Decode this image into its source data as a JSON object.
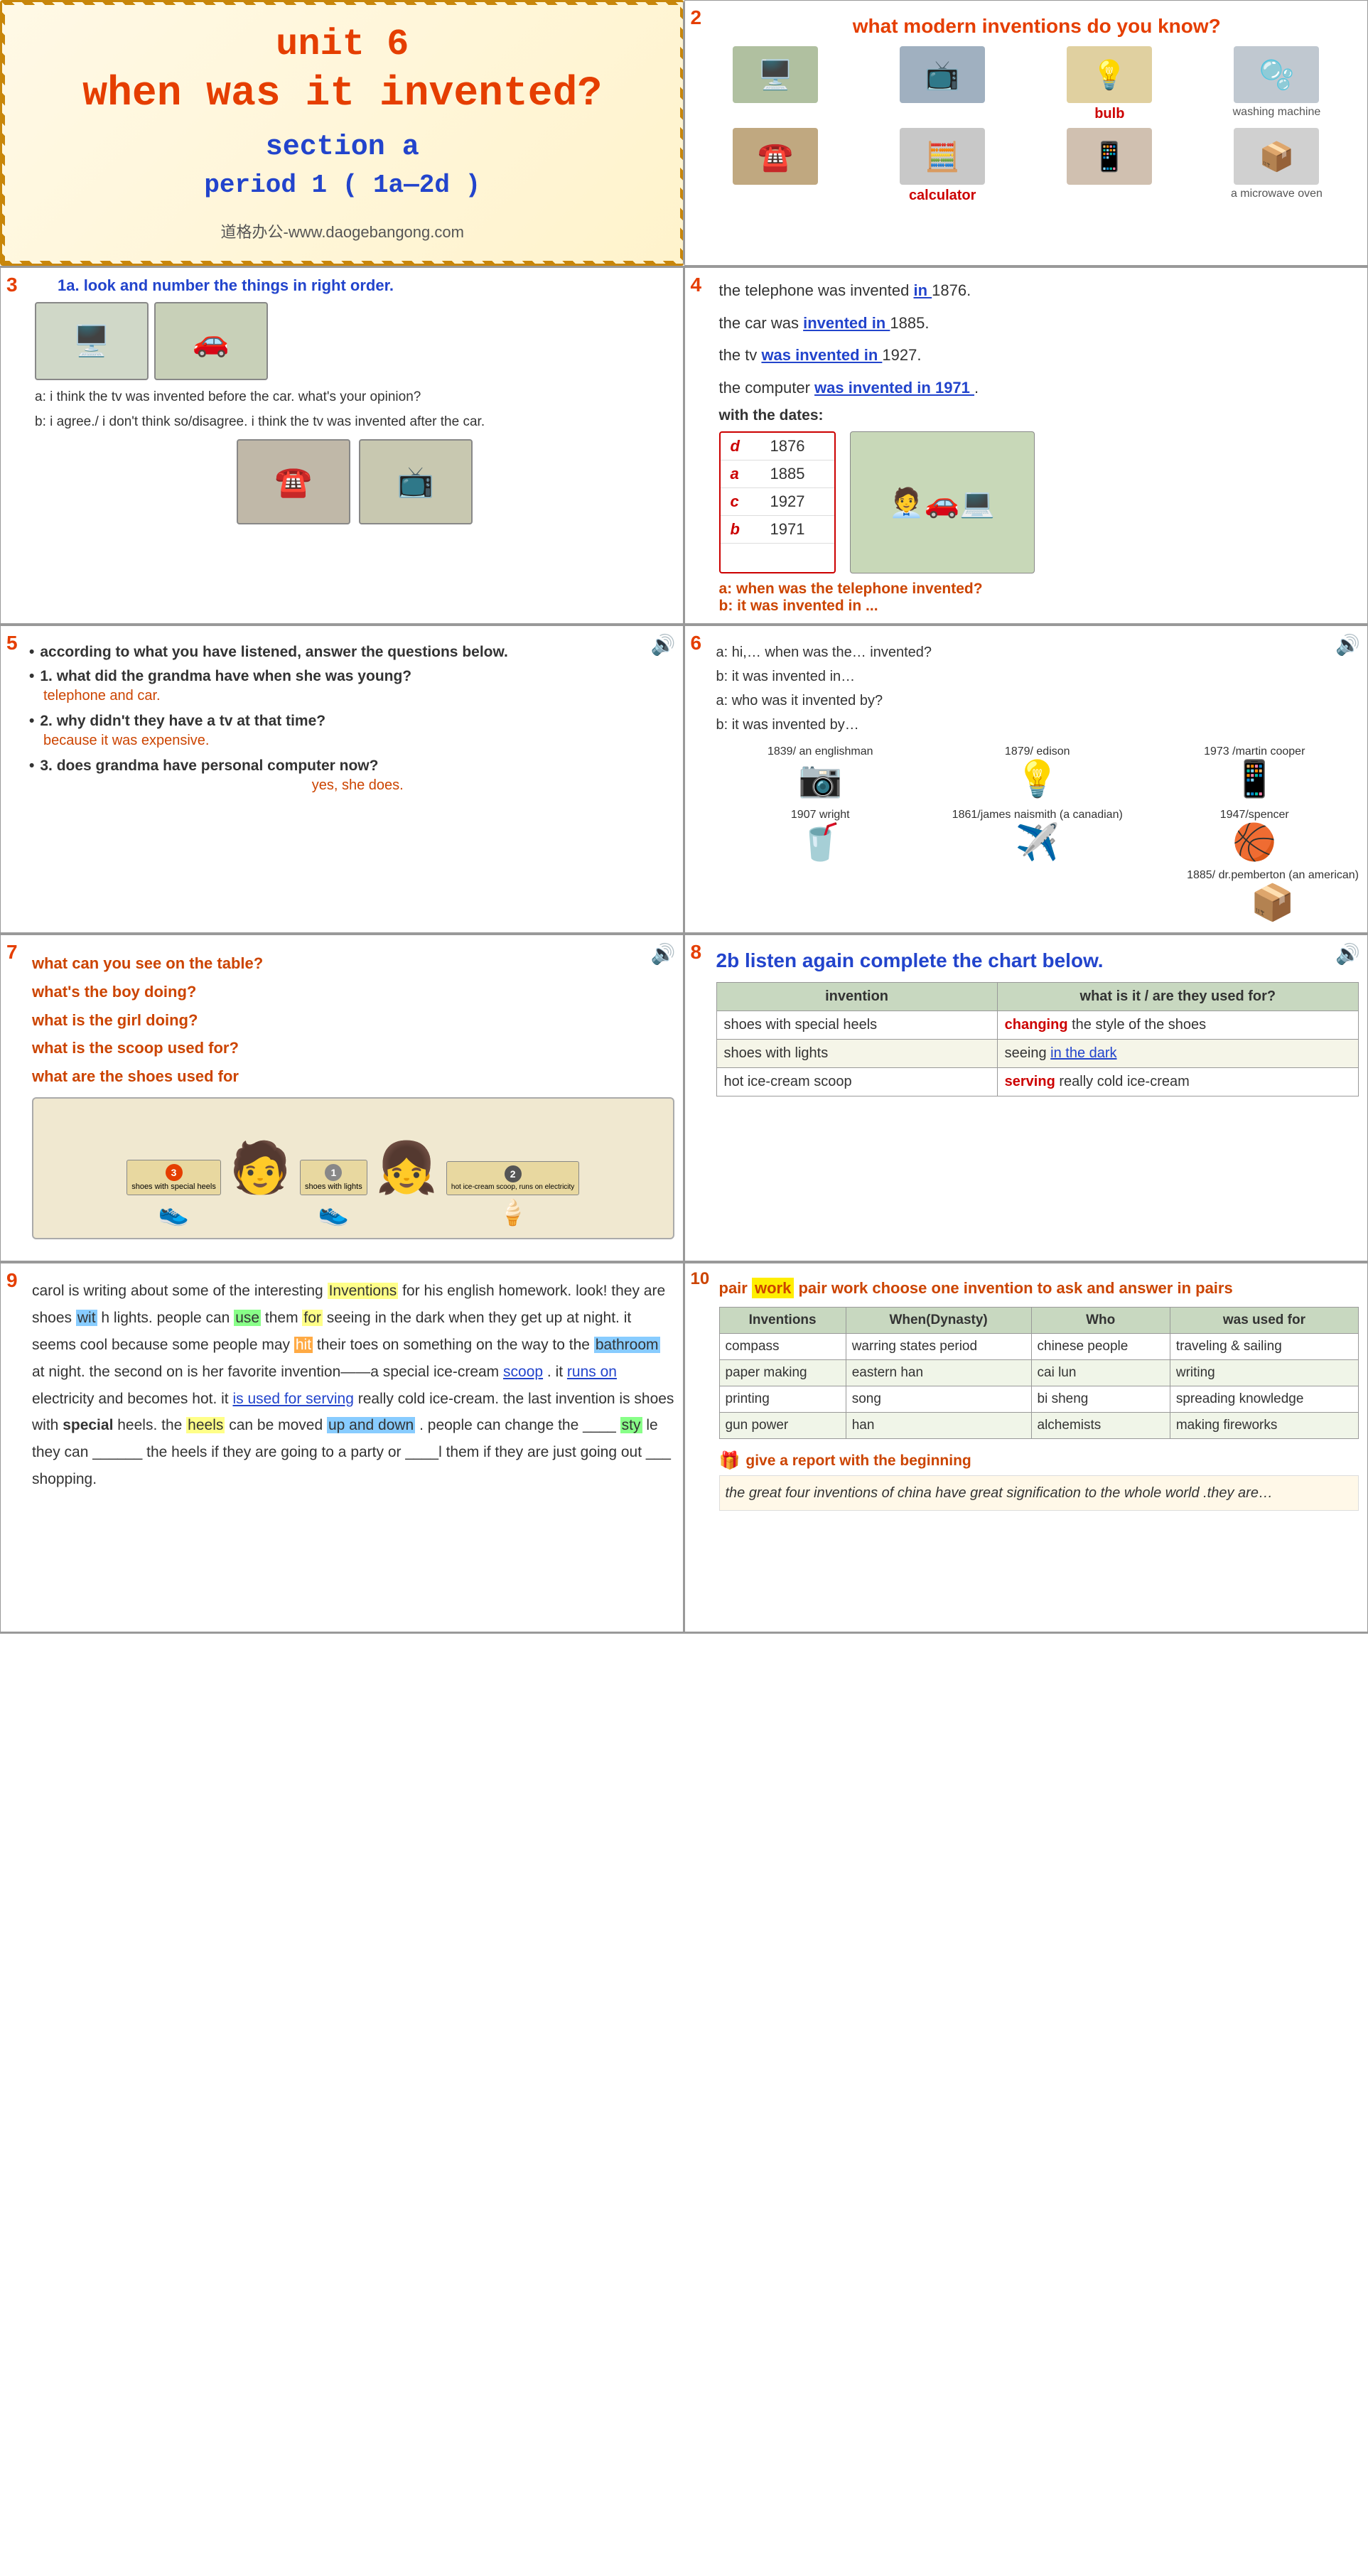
{
  "page": {
    "title": "Unit 6 When Was It Invented?"
  },
  "cell1": {
    "unit": "unit 6",
    "title": "when was it invented?",
    "section": "section a",
    "period": "period 1 ( 1a—2d )",
    "website": "道格办公-www.daogebangong.com"
  },
  "cell2": {
    "num": "2",
    "title": "what modern inventions do you know?",
    "items": [
      {
        "label": "",
        "icon": "🖥️",
        "sublabel": ""
      },
      {
        "label": "",
        "icon": "📺",
        "sublabel": ""
      },
      {
        "label": "bulb",
        "icon": "💡",
        "sublabel": ""
      },
      {
        "label": "",
        "icon": "☎️",
        "sublabel": ""
      },
      {
        "label": "",
        "icon": "🧮",
        "sublabel": ""
      },
      {
        "label": "",
        "icon": "📱",
        "sublabel": ""
      },
      {
        "label": "washing machine",
        "icon": "🫧",
        "sublabel": ""
      },
      {
        "label": "calculator",
        "icon": "🧮",
        "sublabel": ""
      },
      {
        "label": "a microwave oven",
        "icon": "📦",
        "sublabel": ""
      }
    ]
  },
  "cell3": {
    "num": "3",
    "header": "1a. look and number the things in right order.",
    "dialogue_a": "a: i think the tv was invented before the car. what's your opinion?",
    "dialogue_b": "b: i agree./ i don't think so/disagree. i think the tv was invented after the car."
  },
  "cell4": {
    "num": "4",
    "lines": [
      {
        "text": "the telephone was invented",
        "blank": "in",
        "rest": "1876."
      },
      {
        "text": "the car was",
        "blank": "invented in",
        "rest": "1885."
      },
      {
        "text": "the tv",
        "blank": "was invented in",
        "rest": "1927."
      },
      {
        "text": "the computer",
        "blank": "was invented in  1971",
        "rest": "."
      }
    ],
    "subtitle": "with the dates:",
    "dates": [
      {
        "letter": "d",
        "year": "1876"
      },
      {
        "letter": "a",
        "year": "1885"
      },
      {
        "letter": "c",
        "year": "1927"
      },
      {
        "letter": "b",
        "year": "1971"
      }
    ],
    "dialogue_a": "a: when was the telephone invented?",
    "dialogue_b": "b: it was invented in ..."
  },
  "cell5": {
    "num": "5",
    "bullet1": "according to what you have listened, answer the questions below.",
    "q1": "1. what did the grandma have when she was young?",
    "a1": "telephone and car.",
    "q2": "2. why didn't they have a tv at that time?",
    "a2": "because it was expensive.",
    "q3": "3. does grandma have personal computer now?",
    "a3": "yes, she does."
  },
  "cell6": {
    "num": "6",
    "dialogue": [
      "a: hi,… when was the… invented?",
      "b: it was invented in…",
      "a: who was it invented by?",
      "b: it was invented by…"
    ],
    "inventors": [
      {
        "year": "1839/ an englishman",
        "icon": "📷",
        "item": "camera"
      },
      {
        "year": "1879/ edison",
        "icon": "💡",
        "item": "bulb"
      },
      {
        "year": "1973 /martin cooper",
        "icon": "📱",
        "item": "mobile"
      },
      {
        "year": "1885/ dr.pemberton (an american)",
        "icon": "🥤",
        "item": "cola"
      },
      {
        "year": "1907 wright",
        "icon": "✈️",
        "item": "airplane"
      },
      {
        "year": "1861/james naismith (a canadian)",
        "icon": "🏀",
        "item": "basketball"
      },
      {
        "year": "1947/spencer",
        "icon": "📦",
        "item": "microwave"
      }
    ]
  },
  "cell7": {
    "num": "7",
    "questions": [
      "what can you see on the table?",
      "what's the boy doing?",
      "what is the girl doing?",
      "what is the scoop used for?",
      "what are the shoes used for"
    ],
    "scene_items": [
      {
        "num": "3",
        "label": "shoes with special heels"
      },
      {
        "num": "1",
        "label": "shoes with lights"
      },
      {
        "num": "2",
        "label": "hot ice-cream scoop, runs on electricity"
      }
    ]
  },
  "cell8": {
    "num": "8",
    "title": "2b  listen again complete the chart below.",
    "col1": "invention",
    "col2": "what is it / are they used for?",
    "rows": [
      {
        "invention": "shoes with special heels",
        "fill1": "changing",
        "fill2": "the style of the shoes"
      },
      {
        "invention": "shoes with lights",
        "fill1": "seeing",
        "fill2": "in the dark"
      },
      {
        "invention": "hot ice-cream scoop",
        "fill1": "serving",
        "fill2": "really cold ice-cream"
      }
    ]
  },
  "cell9": {
    "num": "9",
    "text_parts": [
      "carol is writing about some of the interesting",
      "Inventions",
      "for his english homework. look! they are shoes ",
      "wit",
      "lights. people can ",
      "use",
      " them ",
      "for",
      " seeing in the dark when they get up at night. it seems cool because some people may ",
      "hit",
      " their toes on something on the way to the ",
      "bathroom",
      " at night. the second on is her favorite invention——a special ice-cream ",
      "scoop",
      ". it ",
      "runs on",
      " electricity and becomes hot. it ",
      "is used for serving",
      " really cold ice-cream. the last invention is shoes with special heels. the ",
      "heels",
      " can be moved ",
      "up and down",
      ". people can change the ____",
      "sty",
      " they can ______ the heels if they are going to a party or ____l them if they are just going out ___ shopping."
    ]
  },
  "cell10": {
    "num": "10",
    "title": "pair work choose one invention to ask and answer in pairs",
    "cols": [
      "Inventions",
      "When(Dynasty)",
      "Who",
      "was used for"
    ],
    "rows": [
      [
        "compass",
        "warring states period",
        "chinese people",
        "traveling & sailing"
      ],
      [
        "paper making",
        "eastern han",
        "cai lun",
        "writing"
      ],
      [
        "printing",
        "song",
        "bi sheng",
        "spreading knowledge"
      ],
      [
        "gun power",
        "han",
        "alchemists",
        "making fireworks"
      ]
    ],
    "report_title": "give a report with the beginning",
    "report_text": "the great four inventions of china have great signification to the whole world .they are…"
  }
}
